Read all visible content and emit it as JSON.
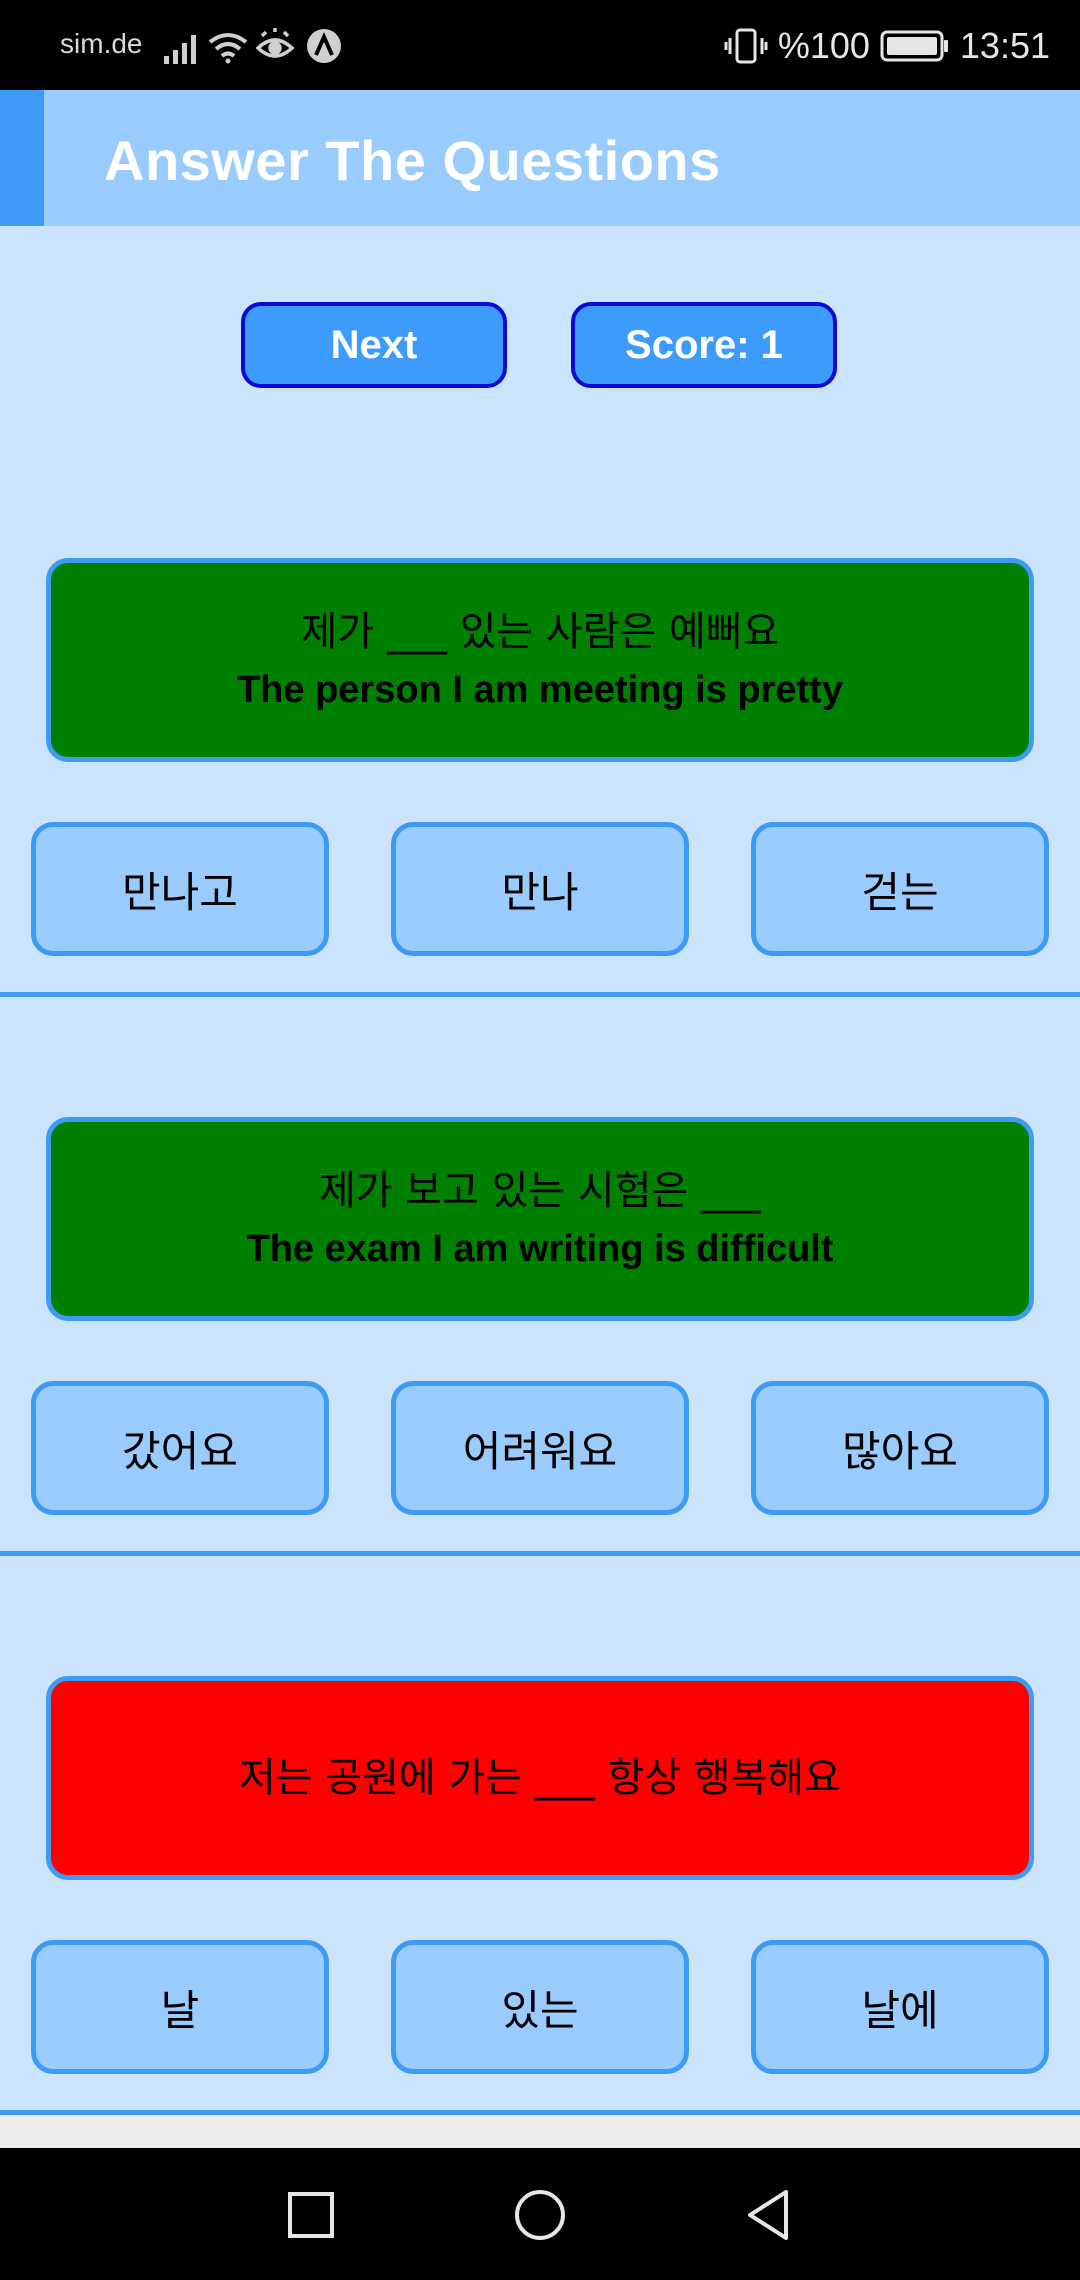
{
  "status_bar": {
    "carrier": "sim.de",
    "battery": "%100",
    "time": "13:51",
    "icons": [
      "signal-icon",
      "wifi-icon",
      "eye-comfort-icon",
      "nav-app-icon",
      "vibrate-icon",
      "battery-icon"
    ]
  },
  "app_bar": {
    "title": "Answer The Questions"
  },
  "controls": {
    "next_label": "Next",
    "score_label": "Score: 1"
  },
  "questions": [
    {
      "korean": "제가 ___ 있는 사람은 예뻐요",
      "english": "The person I am meeting is pretty",
      "status": "correct",
      "options": [
        "만나고",
        "만나",
        "걷는"
      ]
    },
    {
      "korean": "제가 보고 있는 시험은 ___",
      "english": "The exam I am writing is difficult",
      "status": "correct",
      "options": [
        "갔어요",
        "어려워요",
        "많아요"
      ]
    },
    {
      "korean": "저는 공원에 가는 ___ 항상 행복해요",
      "english": "",
      "status": "wrong",
      "options": [
        "날",
        "있는",
        "날에"
      ]
    }
  ],
  "colors": {
    "correct": "#008000",
    "wrong": "#ff0000",
    "accent": "#3d9bf5",
    "background": "#cbe4fb"
  },
  "nav_bar": {
    "icons": [
      "recent-apps-icon",
      "home-icon",
      "back-icon"
    ]
  }
}
